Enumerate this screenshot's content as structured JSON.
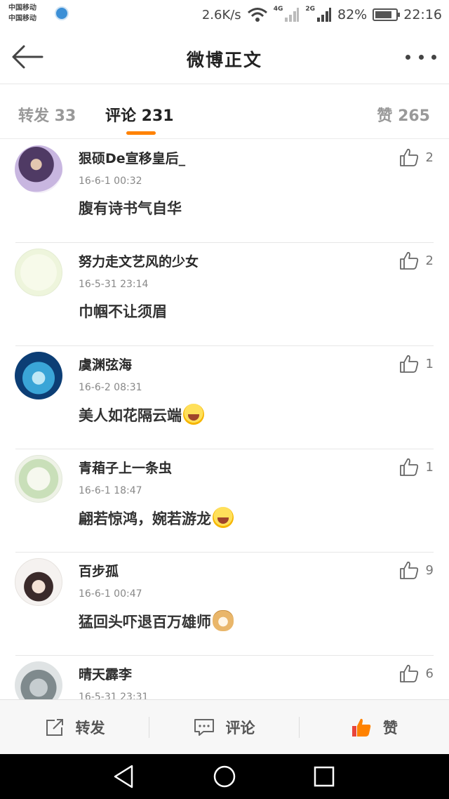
{
  "status_bar": {
    "carrier_1": "中国移动",
    "carrier_2": "中国移动",
    "speed": "2.6K/s",
    "net_1": "4G",
    "net_2": "2G",
    "battery": "82%",
    "battery_level": 0.82,
    "time": "22:16"
  },
  "header": {
    "title": "微博正文"
  },
  "tabs": {
    "repost": "转发 33",
    "comments": "评论 231",
    "likes": "赞 265",
    "active": "comments"
  },
  "comments": [
    {
      "user": "狠硕De宣移皇后_",
      "time": "16-6-1 00:32",
      "text": "腹有诗书气自华",
      "likes": "2",
      "emoji": ""
    },
    {
      "user": "努力走文艺风的少女",
      "time": "16-5-31 23:14",
      "text": "巾帼不让须眉",
      "likes": "2",
      "emoji": ""
    },
    {
      "user": "虞渊弦海",
      "time": "16-6-2 08:31",
      "text": "美人如花隔云端",
      "likes": "1",
      "emoji": "laugh"
    },
    {
      "user": "青葙子上一条虫",
      "time": "16-6-1 18:47",
      "text": "翩若惊鸿，婉若游龙",
      "likes": "1",
      "emoji": "laugh"
    },
    {
      "user": "百步孤",
      "time": "16-6-1 00:47",
      "text": "猛回头吓退百万雄师",
      "likes": "9",
      "emoji": "doge"
    },
    {
      "user": "晴天霹李",
      "time": "16-5-31 23:31",
      "text": "",
      "likes": "6",
      "emoji": ""
    }
  ],
  "action_bar": {
    "repost": "转发",
    "comment": "评论",
    "like": "赞"
  },
  "icons": {
    "back": "back-arrow-icon",
    "more": "more-icon",
    "like": "thumbs-up-icon",
    "repost": "share-icon",
    "comment": "comment-icon",
    "nav_back": "nav-back-icon",
    "nav_home": "nav-home-icon",
    "nav_recent": "nav-recent-icon"
  },
  "colors": {
    "accent": "#ff8200",
    "text": "#333333",
    "muted": "#999999"
  }
}
